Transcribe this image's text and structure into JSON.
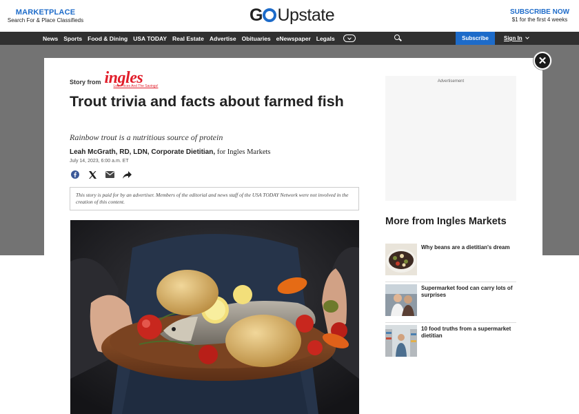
{
  "header": {
    "marketplace_title": "MARKETPLACE",
    "marketplace_sub": "Search For & Place Classifieds",
    "logo_go": "G",
    "logo_rest": "Upstate",
    "subscribe_title": "SUBSCRIBE NOW",
    "subscribe_sub": "$1 for the first 4 weeks"
  },
  "nav": {
    "items": [
      "News",
      "Sports",
      "Food & Dining",
      "USA TODAY",
      "Real Estate",
      "Advertise",
      "Obituaries",
      "eNewspaper",
      "Legals"
    ],
    "subscribe_label": "Subscribe",
    "signin_label": "Sign In"
  },
  "article": {
    "story_from_label": "Story from",
    "sponsor_name": "ingles",
    "sponsor_tagline": "Low Prices And The Savings!",
    "title": "Trout trivia and facts about farmed fish",
    "subtitle": "Rainbow trout is a nutritious source of protein",
    "author": "Leah McGrath, RD, LDN, Corporate Dietitian,",
    "author_org": "for Ingles Markets",
    "date": "July 14, 2023, 6:00 a.m. ET",
    "disclaimer": "This story is paid for by an advertiser. Members of the editorial and news staff of the USA TODAY Network were not involved in the creation of this content."
  },
  "sidebar": {
    "ad_label": "Advertisement",
    "more_title": "More from Ingles Markets",
    "related": [
      {
        "title": "Why beans are a dietitian's dream"
      },
      {
        "title": "Supermarket food can carry lots of surprises"
      },
      {
        "title": "10 food truths from a supermarket dietitian"
      }
    ]
  },
  "modal": {
    "close_symbol": "✕"
  },
  "colors": {
    "brand_blue": "#1d6bc9",
    "nav_bg": "#303030",
    "ingles_red": "#e11d2a"
  }
}
